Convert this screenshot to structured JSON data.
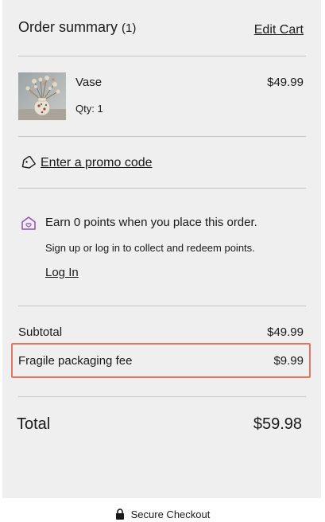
{
  "summary": {
    "title": "Order summary",
    "count": "(1)",
    "edit_cart": "Edit Cart"
  },
  "item": {
    "name": "Vase",
    "qty": "Qty: 1",
    "price": "$49.99",
    "image_icon": "vase-product-image"
  },
  "promo": {
    "icon": "tag-icon",
    "label": "Enter a promo code"
  },
  "points": {
    "icon": "house-points-icon",
    "icon_color": "#8e4fbf",
    "title": "Earn 0 points when you place this order.",
    "subtitle": "Sign up or log in to collect and redeem points.",
    "login": "Log In"
  },
  "totals": {
    "subtotal_label": "Subtotal",
    "subtotal_value": "$49.99",
    "fee_label": "Fragile packaging fee",
    "fee_value": "$9.99",
    "total_label": "Total",
    "total_value": "$59.98",
    "highlight_color": "#e5775e"
  },
  "footer": {
    "icon": "lock-icon",
    "label": "Secure Checkout"
  }
}
